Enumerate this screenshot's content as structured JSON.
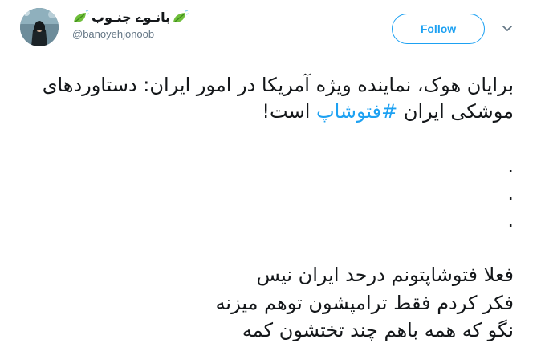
{
  "author": {
    "display_name": "بانـوے جنـوب",
    "handle": "@banoyehjonoob",
    "emoji_icons": [
      "leaf-fluttering-icon",
      "leaf-fluttering-icon"
    ]
  },
  "actions": {
    "follow_label": "Follow",
    "menu_icon": "chevron-down-icon"
  },
  "tweet": {
    "line1": "برایان هوک، نماینده ویژه آمریکا در امور ایران: دستاوردهای",
    "line2_prefix": "موشکی ایران ",
    "hashtag": "#فتوشاپ",
    "line2_suffix": " است!",
    "dots": [
      ".",
      ".",
      "."
    ],
    "lines": [
      "فعلا فتوشاپتونم درحد ایران نیس",
      "فکر کردم فقط ترامپشون توهم میزنه",
      "نگو که همه باهم چند تختشون کمه"
    ]
  },
  "colors": {
    "accent": "#1da1f2",
    "text": "#14171a",
    "muted": "#657786"
  }
}
